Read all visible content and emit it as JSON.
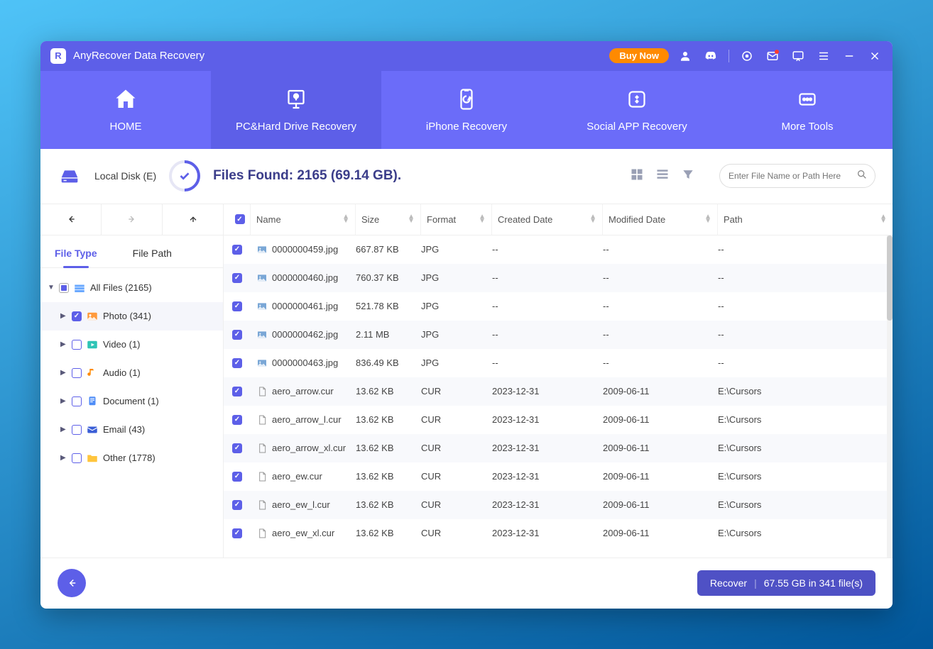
{
  "app": {
    "title": "AnyRecover Data Recovery",
    "logo_letter": "R",
    "buy_label": "Buy Now"
  },
  "tabs": [
    {
      "label": "HOME"
    },
    {
      "label": "PC&Hard Drive Recovery"
    },
    {
      "label": "iPhone Recovery"
    },
    {
      "label": "Social APP Recovery"
    },
    {
      "label": "More Tools"
    }
  ],
  "status": {
    "disk_label": "Local Disk (E)",
    "found_label": "Files Found: 2165 (69.14 GB).",
    "search_placeholder": "Enter File Name or Path Here"
  },
  "tree_tabs": {
    "file_type": "File Type",
    "file_path": "File Path"
  },
  "tree": {
    "root": {
      "label": "All Files (2165)"
    },
    "children": [
      {
        "label": "Photo (341)",
        "checked": true,
        "color": "#ff9a3c"
      },
      {
        "label": "Video (1)",
        "checked": false,
        "color": "#2ec4b6"
      },
      {
        "label": "Audio (1)",
        "checked": false,
        "color": "#ff8a00"
      },
      {
        "label": "Document (1)",
        "checked": false,
        "color": "#4f8df7"
      },
      {
        "label": "Email (43)",
        "checked": false,
        "color": "#3a5ed6"
      },
      {
        "label": "Other (1778)",
        "checked": false,
        "color": "#ffc53d"
      }
    ]
  },
  "columns": {
    "name": "Name",
    "size": "Size",
    "format": "Format",
    "created": "Created Date",
    "modified": "Modified Date",
    "path": "Path"
  },
  "rows": [
    {
      "name": "0000000459.jpg",
      "size": "667.87 KB",
      "fmt": "JPG",
      "cdate": "--",
      "mdate": "--",
      "path": "--",
      "ftype": "img"
    },
    {
      "name": "0000000460.jpg",
      "size": "760.37 KB",
      "fmt": "JPG",
      "cdate": "--",
      "mdate": "--",
      "path": "--",
      "ftype": "img"
    },
    {
      "name": "0000000461.jpg",
      "size": "521.78 KB",
      "fmt": "JPG",
      "cdate": "--",
      "mdate": "--",
      "path": "--",
      "ftype": "img"
    },
    {
      "name": "0000000462.jpg",
      "size": "2.11 MB",
      "fmt": "JPG",
      "cdate": "--",
      "mdate": "--",
      "path": "--",
      "ftype": "img"
    },
    {
      "name": "0000000463.jpg",
      "size": "836.49 KB",
      "fmt": "JPG",
      "cdate": "--",
      "mdate": "--",
      "path": "--",
      "ftype": "img"
    },
    {
      "name": "aero_arrow.cur",
      "size": "13.62 KB",
      "fmt": "CUR",
      "cdate": "2023-12-31",
      "mdate": "2009-06-11",
      "path": "E:\\Cursors",
      "ftype": "file"
    },
    {
      "name": "aero_arrow_l.cur",
      "size": "13.62 KB",
      "fmt": "CUR",
      "cdate": "2023-12-31",
      "mdate": "2009-06-11",
      "path": "E:\\Cursors",
      "ftype": "file"
    },
    {
      "name": "aero_arrow_xl.cur",
      "size": "13.62 KB",
      "fmt": "CUR",
      "cdate": "2023-12-31",
      "mdate": "2009-06-11",
      "path": "E:\\Cursors",
      "ftype": "file"
    },
    {
      "name": "aero_ew.cur",
      "size": "13.62 KB",
      "fmt": "CUR",
      "cdate": "2023-12-31",
      "mdate": "2009-06-11",
      "path": "E:\\Cursors",
      "ftype": "file"
    },
    {
      "name": "aero_ew_l.cur",
      "size": "13.62 KB",
      "fmt": "CUR",
      "cdate": "2023-12-31",
      "mdate": "2009-06-11",
      "path": "E:\\Cursors",
      "ftype": "file"
    },
    {
      "name": "aero_ew_xl.cur",
      "size": "13.62 KB",
      "fmt": "CUR",
      "cdate": "2023-12-31",
      "mdate": "2009-06-11",
      "path": "E:\\Cursors",
      "ftype": "file"
    }
  ],
  "footer": {
    "recover_label": "Recover",
    "recover_info": "67.55 GB in 341 file(s)"
  }
}
